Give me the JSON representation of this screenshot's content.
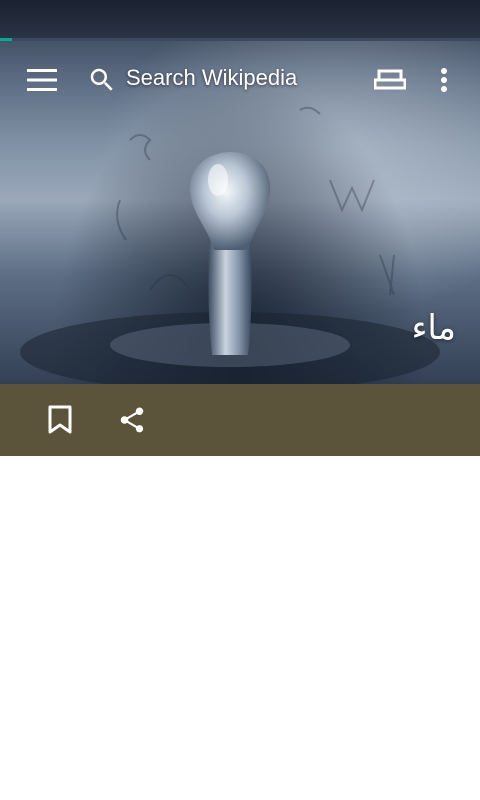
{
  "toolbar": {
    "search_placeholder": "Search Wikipedia",
    "icons": [
      "menu-icon",
      "search-icon",
      "reading-mode-icon",
      "more-vert-icon"
    ]
  },
  "page_load": {
    "progress": 0.025,
    "color": "#00af89"
  },
  "article": {
    "title": "ماء"
  },
  "actions": {
    "icons": [
      "bookmark-icon",
      "share-icon"
    ],
    "bar_color": "#5b543a"
  }
}
